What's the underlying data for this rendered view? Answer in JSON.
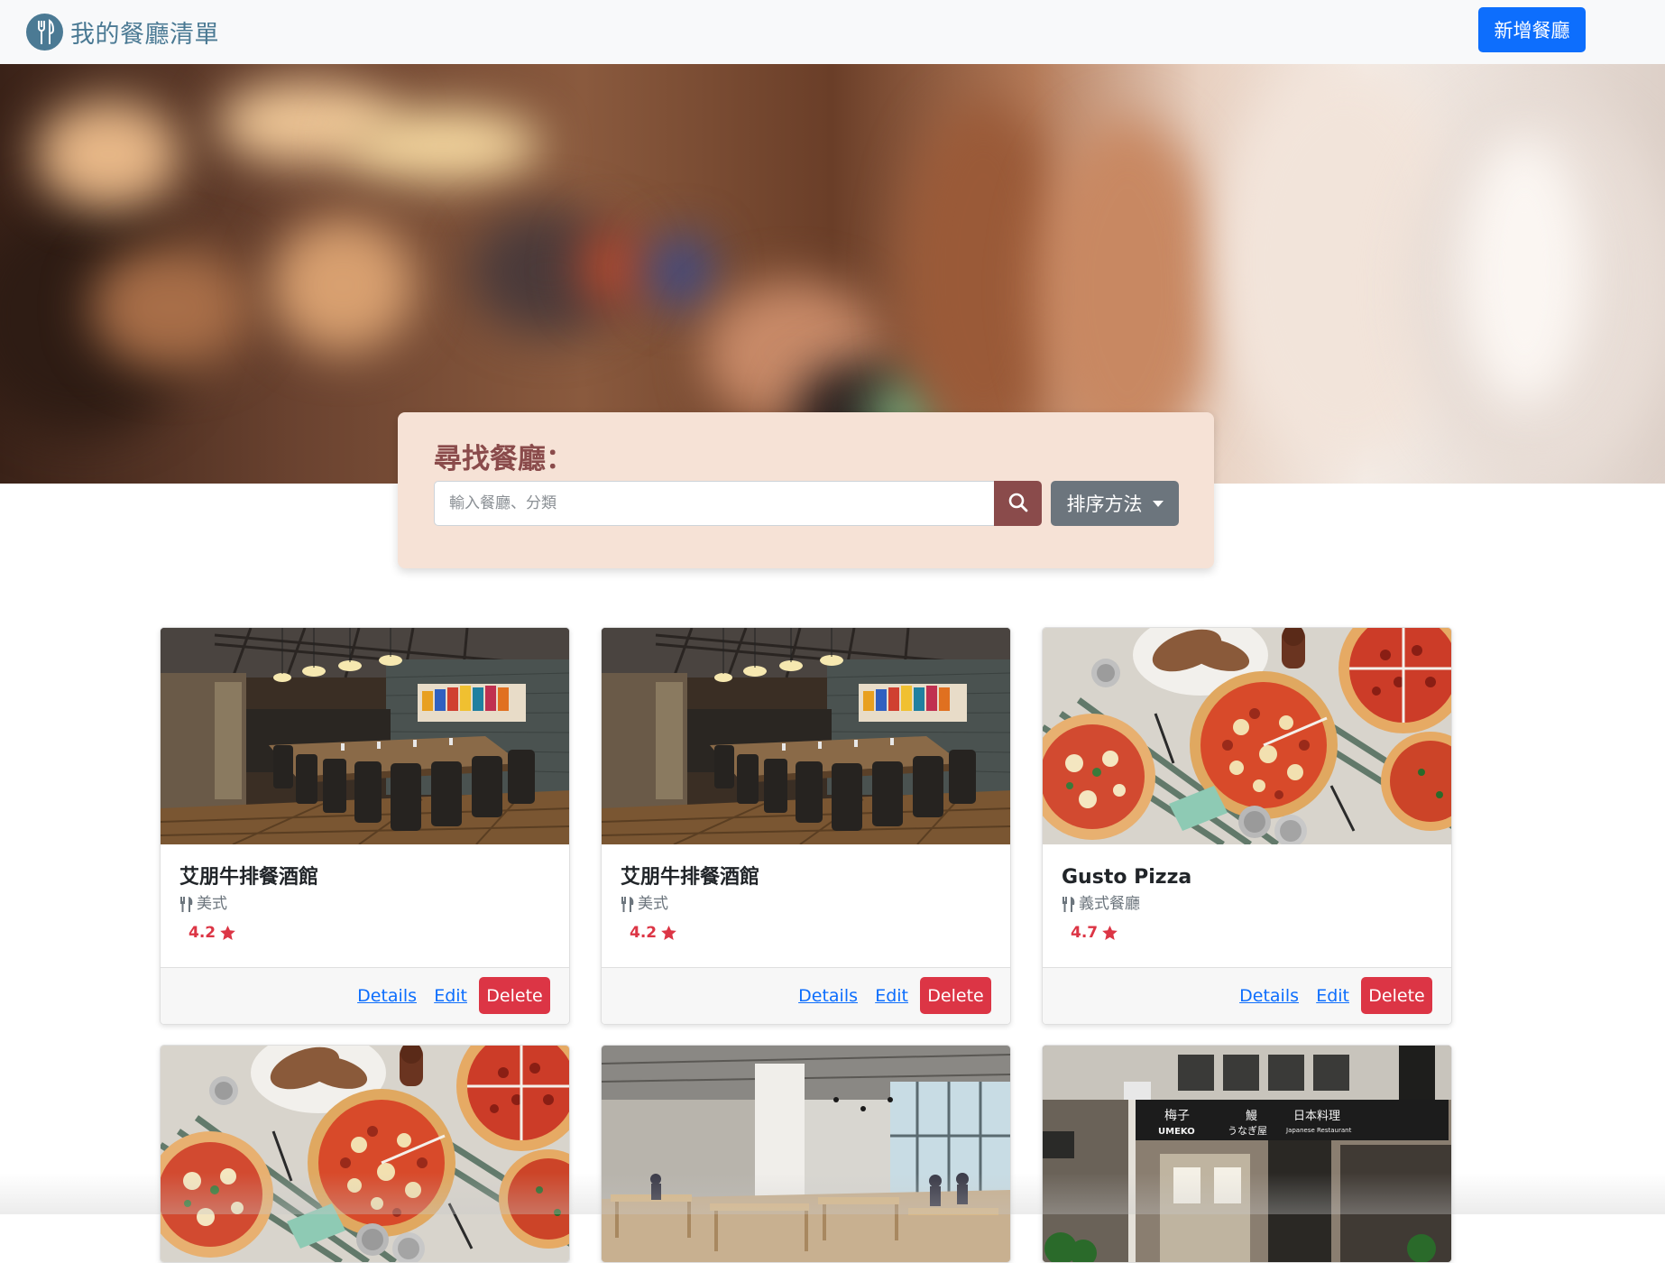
{
  "navbar": {
    "brand_text": "我的餐廳清單",
    "add_button_label": "新增餐廳"
  },
  "search": {
    "title": "尋找餐廳：",
    "input_value": "",
    "placeholder": "輸入餐廳、分類",
    "sort_label": "排序方法"
  },
  "restaurants": [
    {
      "name": "艾朋牛排餐酒館",
      "category": "美式",
      "rating": "4.2",
      "image": "steakhouse-dining-room",
      "actions": {
        "details": "Details",
        "edit": "Edit",
        "delete": "Delete"
      }
    },
    {
      "name": "艾朋牛排餐酒館",
      "category": "美式",
      "rating": "4.2",
      "image": "steakhouse-dining-room",
      "actions": {
        "details": "Details",
        "edit": "Edit",
        "delete": "Delete"
      }
    },
    {
      "name": "Gusto Pizza",
      "category": "義式餐廳",
      "rating": "4.7",
      "image": "pizza-table",
      "actions": {
        "details": "Details",
        "edit": "Edit",
        "delete": "Delete"
      }
    },
    {
      "image": "pizza-table"
    },
    {
      "image": "cafe-interior"
    },
    {
      "image": "japanese-storefront",
      "sign_texts": [
        "梅子",
        "UMEKO",
        "鰻",
        "うなぎ屋",
        "日本料理",
        "Japanese Restaurant"
      ]
    }
  ],
  "colors": {
    "brand": "#4b7a94",
    "primary": "#0d6efd",
    "search_panel": "#f6e2d6",
    "search_accent": "#8a4b4b",
    "secondary": "#6c757d",
    "danger": "#dc3545"
  },
  "icons": {
    "brand": "utensils-circle-icon",
    "search": "search-icon",
    "sort": "caret-down-icon",
    "category": "utensils-icon",
    "rating": "star-icon"
  }
}
